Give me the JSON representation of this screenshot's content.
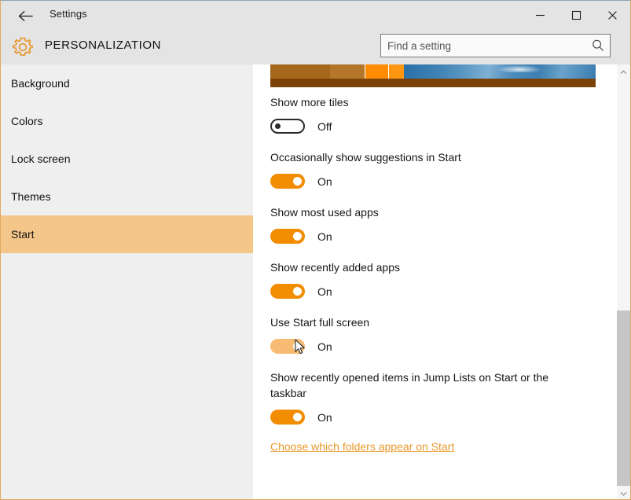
{
  "window": {
    "app_title": "Settings",
    "back_icon": "back-arrow-icon",
    "minimize_label": "─",
    "maximize_label": "□",
    "close_label": "✕"
  },
  "header": {
    "gear_icon": "gear-icon",
    "page_title": "PERSONALIZATION",
    "search": {
      "placeholder": "Find a setting",
      "value": "",
      "icon": "search-icon"
    }
  },
  "sidebar": {
    "items": [
      {
        "label": "Background",
        "selected": false
      },
      {
        "label": "Colors",
        "selected": false
      },
      {
        "label": "Lock screen",
        "selected": false
      },
      {
        "label": "Themes",
        "selected": false
      },
      {
        "label": "Start",
        "selected": true
      }
    ]
  },
  "main": {
    "preview": {
      "name": "start-menu-preview",
      "tile_colors": [
        "#a5671b",
        "#b3762a",
        "#ff8c00",
        "#ff9612",
        "#ff8c00",
        "#ff9a1f",
        "#ff8c00"
      ],
      "taskbar_color": "#7a4208"
    },
    "settings": [
      {
        "label": "Show more tiles",
        "state": "Off",
        "on": false,
        "hover": false
      },
      {
        "label": "Occasionally show suggestions in Start",
        "state": "On",
        "on": true,
        "hover": false
      },
      {
        "label": "Show most used apps",
        "state": "On",
        "on": true,
        "hover": false
      },
      {
        "label": "Show recently added apps",
        "state": "On",
        "on": true,
        "hover": false
      },
      {
        "label": "Use Start full screen",
        "state": "On",
        "on": true,
        "hover": true
      },
      {
        "label": "Show recently opened items in Jump Lists on Start or the taskbar",
        "state": "On",
        "on": true,
        "hover": false
      }
    ],
    "link": "Choose which folders appear on Start",
    "scrollbar": {
      "up_icon": "chevron-up-icon",
      "down_icon": "chevron-down-icon"
    }
  },
  "colors": {
    "accent": "#f28c00",
    "accent_hover": "#f7bb74",
    "selection": "#f5c68a",
    "link": "#e8992c",
    "chrome": "#e4e4e4",
    "sidebar": "#efefef",
    "border": "#e0a864"
  }
}
